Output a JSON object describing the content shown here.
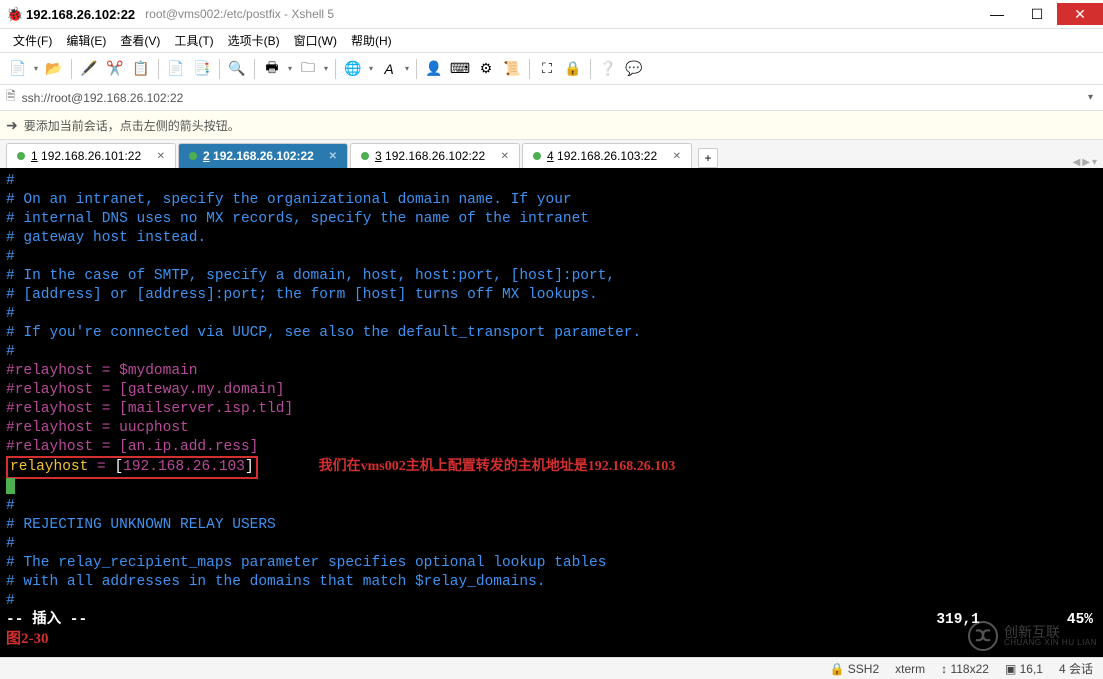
{
  "window": {
    "title_main": "192.168.26.102:22",
    "title_sub": "root@vms002:/etc/postfix - Xshell 5"
  },
  "menu": {
    "file": "文件(F)",
    "edit": "编辑(E)",
    "view": "查看(V)",
    "tools": "工具(T)",
    "tabs": "选项卡(B)",
    "window": "窗口(W)",
    "help": "帮助(H)"
  },
  "address": {
    "url": "ssh://root@192.168.26.102:22"
  },
  "hint": {
    "text": "要添加当前会话，点击左侧的箭头按钮。"
  },
  "tabs": [
    {
      "num": "1",
      "label": "192.168.26.101:22",
      "active": false
    },
    {
      "num": "2",
      "label": "192.168.26.102:22",
      "active": true
    },
    {
      "num": "3",
      "label": "192.168.26.102:22",
      "active": false
    },
    {
      "num": "4",
      "label": "192.168.26.103:22",
      "active": false
    }
  ],
  "term": {
    "l1": "#",
    "l2": "# On an intranet, specify the organizational domain name. If your",
    "l3": "# internal DNS uses no MX records, specify the name of the intranet",
    "l4": "# gateway host instead.",
    "l5": "#",
    "l6": "# In the case of SMTP, specify a domain, host, host:port, [host]:port,",
    "l7": "# [address] or [address]:port; the form [host] turns off MX lookups.",
    "l8": "#",
    "l9": "# If you're connected via UUCP, see also the default_transport parameter.",
    "l10": "#",
    "l11": "#relayhost = $mydomain",
    "l12": "#relayhost = [gateway.my.domain]",
    "l13": "#relayhost = [mailserver.isp.tld]",
    "l14": "#relayhost = uucphost",
    "l15": "#relayhost = [an.ip.add.ress]",
    "relay_key": "relayhost",
    "relay_eq": " = ",
    "relay_lb": "[",
    "relay_val": "192.168.26.103",
    "relay_rb": "]",
    "annotation": "我们在vms002主机上配置转发的主机地址是192.168.26.103",
    "l17": "#",
    "l18": "# REJECTING UNKNOWN RELAY USERS",
    "l19": "#",
    "l20": "# The relay_recipient_maps parameter specifies optional lookup tables",
    "l21": "# with all addresses in the domains that match $relay_domains.",
    "l22": "#",
    "mode": "-- 插入 --",
    "pos": "319,1",
    "percent": "45%",
    "caption": "图2-30"
  },
  "status": {
    "proto": "SSH2",
    "term_type": "xterm",
    "size": "118x22",
    "cursor": "16,1",
    "sessions": "4 会话"
  },
  "watermark": {
    "cn": "创新互联",
    "en": "CHUANG XIN HU LIAN"
  }
}
